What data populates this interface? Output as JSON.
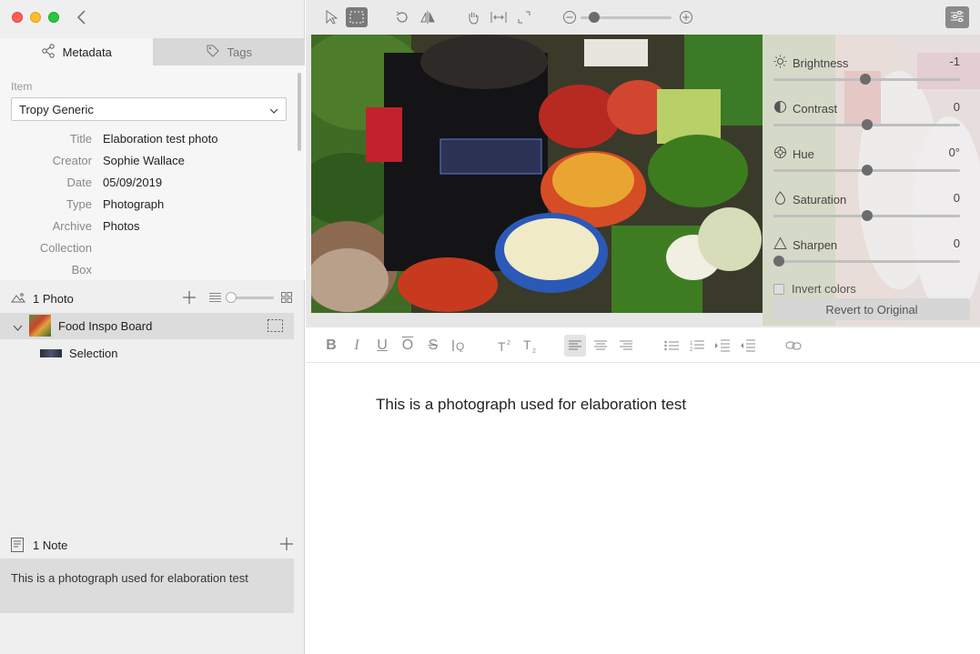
{
  "sidebar": {
    "tabs": {
      "metadata": "Metadata",
      "tags": "Tags"
    },
    "item_label": "Item",
    "template": "Tropy Generic",
    "fields": [
      {
        "label": "Title",
        "value": "Elaboration test photo"
      },
      {
        "label": "Creator",
        "value": "Sophie Wallace"
      },
      {
        "label": "Date",
        "value": "05/09/2019"
      },
      {
        "label": "Type",
        "value": "Photograph"
      },
      {
        "label": "Archive",
        "value": "Photos"
      },
      {
        "label": "Collection",
        "value": ""
      },
      {
        "label": "Box",
        "value": ""
      }
    ],
    "photos": {
      "count": "1 Photo",
      "items": [
        {
          "name": "Food Inspo Board"
        },
        {
          "name": "Selection"
        }
      ]
    },
    "notes": {
      "count": "1 Note",
      "items": [
        {
          "text": "This is a photograph used for elaboration test"
        }
      ]
    }
  },
  "adjustments": [
    {
      "name": "Brightness",
      "value": "-1",
      "level": 0.49,
      "icon": "sun-icon"
    },
    {
      "name": "Contrast",
      "value": "0",
      "level": 0.5,
      "icon": "contrast-icon"
    },
    {
      "name": "Hue",
      "value": "0°",
      "level": 0.5,
      "icon": "hue-icon"
    },
    {
      "name": "Saturation",
      "value": "0",
      "level": 0.5,
      "icon": "droplet-icon"
    },
    {
      "name": "Sharpen",
      "value": "0",
      "level": 0.0,
      "icon": "triangle-icon"
    }
  ],
  "invert_label": "Invert colors",
  "revert_label": "Revert to Original",
  "zoom_level": 0.1,
  "editor": {
    "text": "This is a photograph used for elaboration test"
  },
  "colors": {
    "selection_border": "#5b7bd9",
    "knob": "#6c6c6c"
  }
}
